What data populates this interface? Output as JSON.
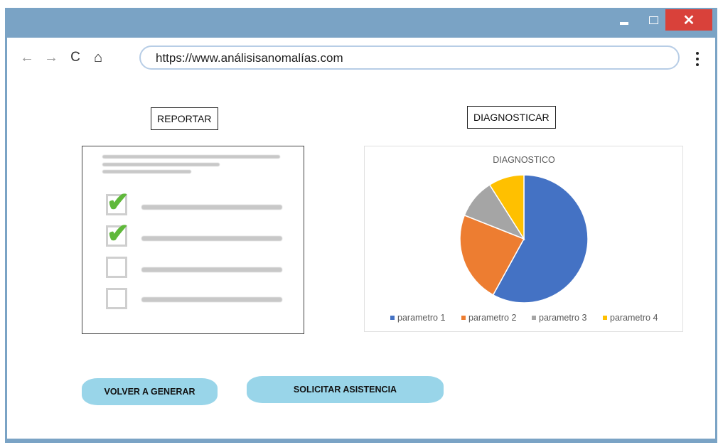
{
  "window": {
    "controls": {
      "close_glyph": "✕"
    }
  },
  "browser": {
    "back_glyph": "←",
    "forward_glyph": "→",
    "reload_glyph": "C",
    "home_glyph": "⌂",
    "url": "https://www.análisisanomalías.com"
  },
  "page": {
    "report_label": "REPORTAR",
    "diagnose_label": "DIAGNOSTICAR",
    "checklist": [
      {
        "checked": true
      },
      {
        "checked": true
      },
      {
        "checked": false
      },
      {
        "checked": false
      }
    ],
    "buttons": {
      "regenerate": "VOLVER A GENERAR",
      "assistance": "SOLICITAR ASISTENCIA"
    }
  },
  "chart_data": {
    "type": "pie",
    "title": "DIAGNOSTICO",
    "categories": [
      "parametro 1",
      "parametro 2",
      "parametro 3",
      "parametro 4"
    ],
    "values": [
      58,
      23,
      10,
      9
    ],
    "colors": [
      "#4472c4",
      "#ed7d31",
      "#a5a5a5",
      "#ffc000"
    ],
    "legend": "bottom"
  },
  "colors": {
    "window_frame": "#7aa3c5",
    "close_button": "#d9413a",
    "button_fill": "#99d5e9",
    "check_green": "#5fb83a"
  }
}
